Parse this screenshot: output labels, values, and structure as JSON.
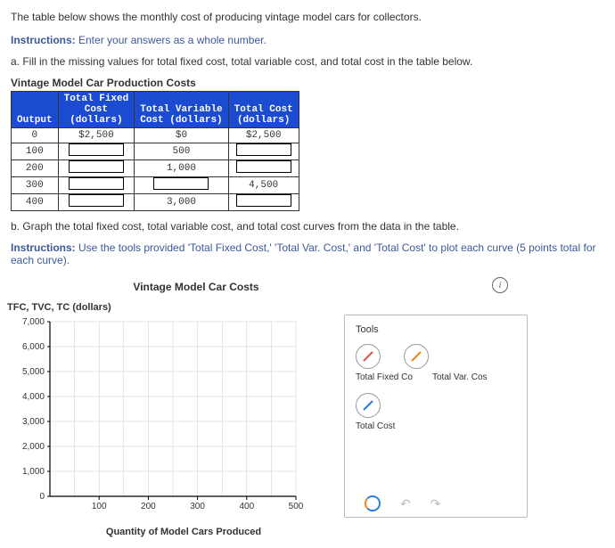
{
  "intro": "The table below shows the monthly cost of producing vintage model cars for collectors.",
  "instr1_label": "Instructions:",
  "instr1_text": " Enter your answers as a whole number.",
  "part_a": "a. Fill in the missing values for total fixed cost, total variable cost, and total cost in the table below.",
  "table_title": "Vintage Model Car Production Costs",
  "headers": {
    "output": "Output",
    "tfc1": "Total Fixed",
    "tfc2": "Cost",
    "tfc3": "(dollars)",
    "tvc1": "Total Variable",
    "tvc2": "Cost (dollars)",
    "tc1": "Total Cost",
    "tc2": "(dollars)"
  },
  "rows": [
    {
      "output": "0",
      "tfc": "$2,500",
      "tvc": "$0",
      "tc": "$2,500"
    },
    {
      "output": "100",
      "tfc": "[input]",
      "tvc": "500",
      "tc": "[input]"
    },
    {
      "output": "200",
      "tfc": "[input]",
      "tvc": "1,000",
      "tc": "[input]"
    },
    {
      "output": "300",
      "tfc": "[input]",
      "tvc": "[input]",
      "tc": "4,500"
    },
    {
      "output": "400",
      "tfc": "[input]",
      "tvc": "3,000",
      "tc": "[input]"
    }
  ],
  "part_b": "b. Graph the total fixed cost, total variable cost, and total cost curves from the data in the table.",
  "instr2_label": "Instructions:",
  "instr2_text": " Use the tools provided 'Total Fixed Cost,' 'Total Var. Cost,' and 'Total Cost' to plot each curve (5 points total for each curve).",
  "chart": {
    "title": "Vintage Model Car Costs",
    "ylabel": "TFC, TVC, TC (dollars)",
    "xlabel": "Quantity of Model Cars Produced",
    "yticks": [
      "7,000",
      "6,000",
      "5,000",
      "4,000",
      "3,000",
      "2,000",
      "1,000",
      "0"
    ],
    "xticks": [
      "100",
      "200",
      "300",
      "400",
      "500"
    ]
  },
  "tools": {
    "head": "Tools",
    "l1": "Total Fixed Co",
    "l2": "Total Var. Cos",
    "l3": "Total Cost"
  },
  "info_icon": "i",
  "chart_data": {
    "type": "line",
    "title": "Vintage Model Car Costs",
    "xlabel": "Quantity of Model Cars Produced",
    "ylabel": "TFC, TVC, TC (dollars)",
    "xlim": [
      0,
      500
    ],
    "ylim": [
      0,
      7000
    ],
    "series": [
      {
        "name": "Total Fixed Cost",
        "values": []
      },
      {
        "name": "Total Var. Cost",
        "values": []
      },
      {
        "name": "Total Cost",
        "values": []
      }
    ],
    "note": "empty plot — no curves drawn yet"
  }
}
